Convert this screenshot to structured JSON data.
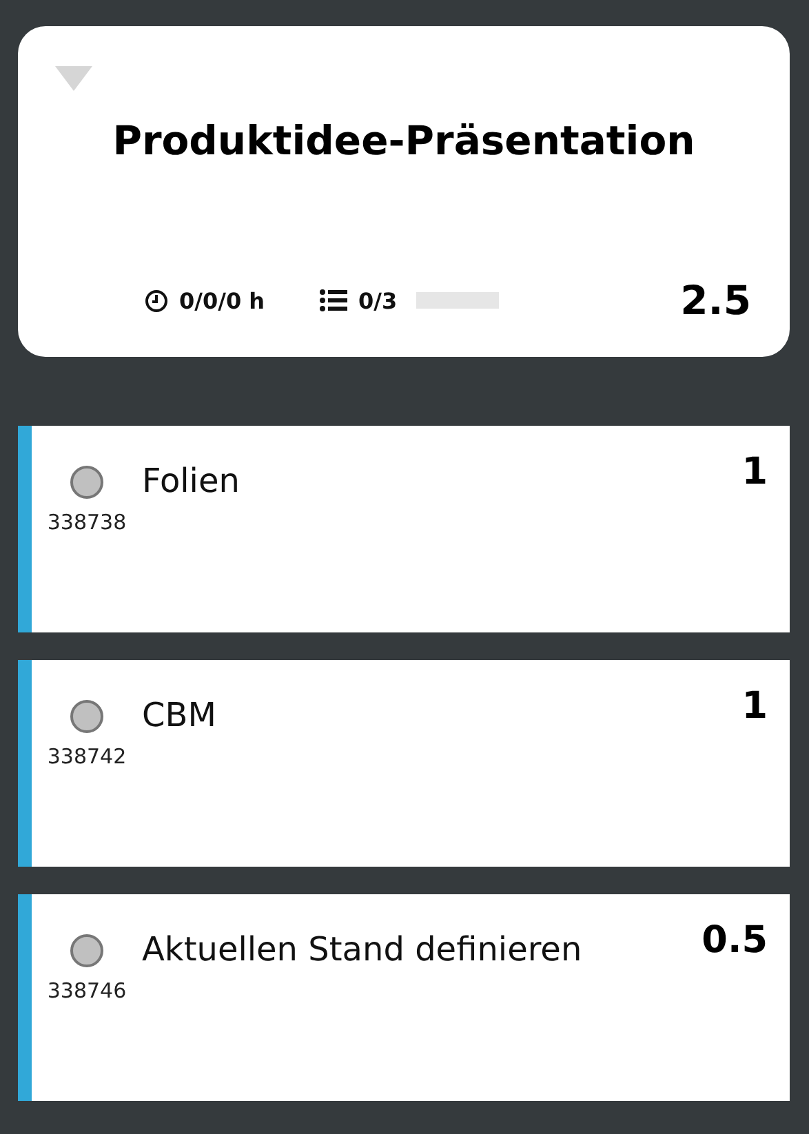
{
  "header_card": {
    "expanded": true,
    "title": "Produktidee-Präsentation",
    "time": "0/0/0 h",
    "tasks": "0/3",
    "progress": {
      "level": 0
    },
    "points": "2.5"
  },
  "tasks": [
    {
      "title": "Folien",
      "id": "338738",
      "points": "1",
      "done": false,
      "color": "#31a8d8"
    },
    {
      "title": "CBM",
      "id": "338742",
      "points": "1",
      "done": false,
      "color": "#31a8d8"
    },
    {
      "title": "Aktuellen Stand definieren",
      "id": "338746",
      "points": "0.5",
      "done": false,
      "color": "#31a8d8"
    }
  ]
}
